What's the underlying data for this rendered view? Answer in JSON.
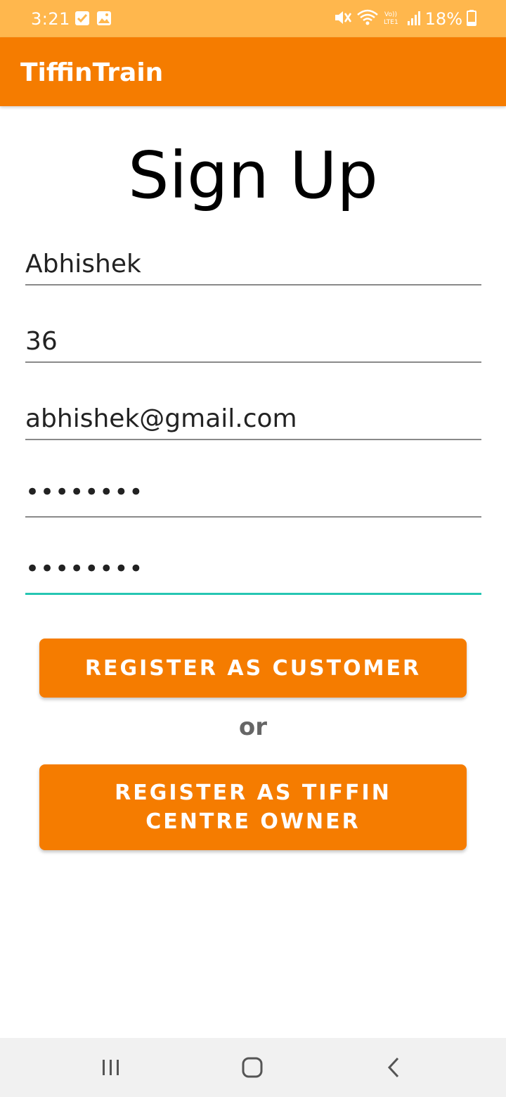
{
  "status_bar": {
    "time": "3:21",
    "battery": "18%",
    "icons": [
      "checkbox-notification-icon",
      "image-notification-icon",
      "mute-icon",
      "wifi-icon",
      "volte-lte-icon",
      "signal-icon",
      "battery-icon"
    ]
  },
  "app_bar": {
    "title": "TiffinTrain"
  },
  "form": {
    "heading": "Sign Up",
    "name_value": "Abhishek",
    "age_value": "36",
    "email_value": "abhishek@gmail.com",
    "password_value": "••••••••",
    "confirm_password_value": "••••••••",
    "focused_field": "confirm_password",
    "focus_color": "#26C6B3"
  },
  "actions": {
    "register_customer_label": "REGISTER AS CUSTOMER",
    "or_label": "or",
    "register_owner_label": "REGISTER AS TIFFIN CENTRE OWNER"
  },
  "nav_bar": {
    "buttons": [
      "recent-apps-icon",
      "home-icon",
      "back-icon"
    ]
  },
  "colors": {
    "accent": "#F57C00",
    "status_bar": "#FFB74D"
  }
}
